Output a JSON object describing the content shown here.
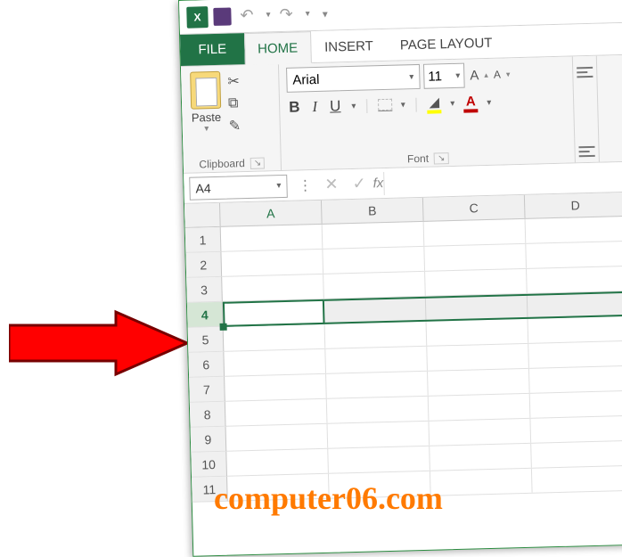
{
  "qat": {
    "app_icon_label": "X"
  },
  "tabs": {
    "file": "FILE",
    "home": "HOME",
    "insert": "INSERT",
    "page_layout": "PAGE LAYOUT"
  },
  "ribbon": {
    "clipboard": {
      "paste_label": "Paste",
      "group_label": "Clipboard"
    },
    "font": {
      "font_name": "Arial",
      "font_size": "11",
      "bold": "B",
      "italic": "I",
      "underline": "U",
      "text_A": "A",
      "inc": "A",
      "dec": "A",
      "group_label": "Font"
    }
  },
  "name_box": "A4",
  "fx_label": "fx",
  "columns": [
    "A",
    "B",
    "C",
    "D"
  ],
  "rows": [
    "1",
    "2",
    "3",
    "4",
    "5",
    "6",
    "7",
    "8",
    "9",
    "10",
    "11"
  ],
  "selected_row": "4",
  "watermark": "computer06.com"
}
